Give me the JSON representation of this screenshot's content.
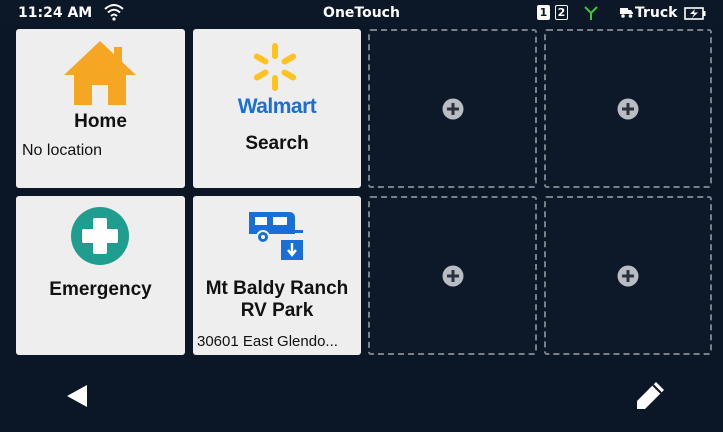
{
  "status": {
    "time": "11:24 AM",
    "app_title": "OneTouch",
    "slot1": "1",
    "slot2": "2",
    "vehicle": "Truck"
  },
  "tiles": [
    {
      "title": "Home",
      "subtitle": "No location",
      "icon": "house-icon",
      "color": "#f5a623"
    },
    {
      "brand": "Walmart",
      "title": "Search",
      "icon": "walmart-spark-icon",
      "color": "#1a6fd6"
    },
    {
      "title": "Emergency",
      "icon": "medical-cross-icon",
      "color": "#1f9e8f"
    },
    {
      "title": "Mt Baldy Ranch RV Park",
      "subtitle": "30601 East Glendo...",
      "icon": "rv-park-icon",
      "color": "#1a6fd6"
    }
  ],
  "empty_slots": 4,
  "nav": {
    "back": "back-arrow-icon",
    "edit": "pencil-icon"
  }
}
